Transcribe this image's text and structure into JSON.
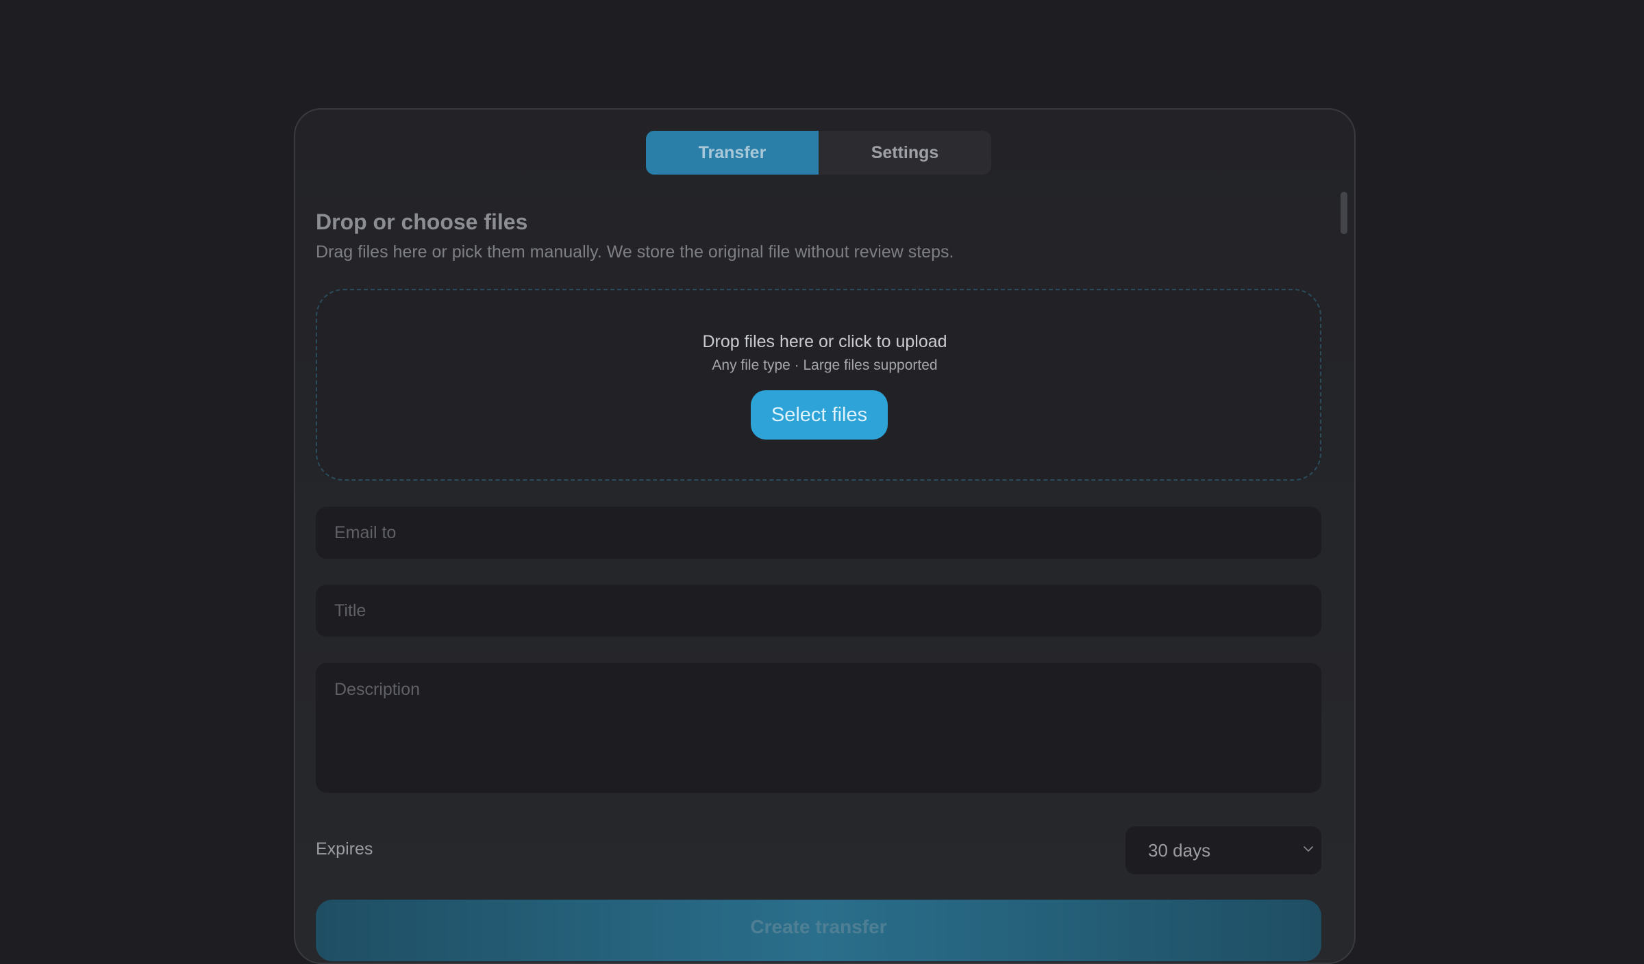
{
  "tabs": [
    {
      "label": "Transfer",
      "active": true
    },
    {
      "label": "Settings",
      "active": false
    }
  ],
  "section": {
    "title": "Drop or choose files",
    "subtitle": "Drag files here or pick them manually. We store the original file without review steps."
  },
  "dropzone": {
    "title": "Drop files here or click to upload",
    "subtitle": "Any file type · Large files supported",
    "button_label": "Select files"
  },
  "form": {
    "email_placeholder": "Email to",
    "title_placeholder": "Title",
    "description_placeholder": "Description",
    "expires_label": "Expires",
    "expires_value": "30 days",
    "submit_label": "Create transfer"
  },
  "colors": {
    "accent": "#2ea3d8",
    "tab_active": "#2a7fa8",
    "background": "#1e1e22"
  }
}
